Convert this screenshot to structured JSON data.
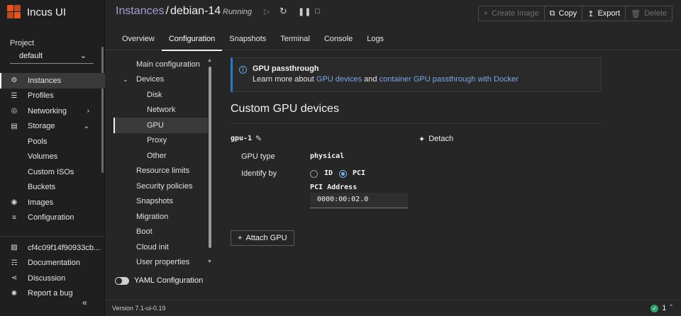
{
  "app": {
    "name": "Incus UI"
  },
  "sidebar": {
    "project_label": "Project",
    "project_value": "default",
    "items": [
      {
        "label": "Instances",
        "icon": "instances-icon"
      },
      {
        "label": "Profiles",
        "icon": "profiles-icon"
      },
      {
        "label": "Networking",
        "icon": "networking-icon"
      },
      {
        "label": "Storage",
        "icon": "storage-icon"
      },
      {
        "label": "Pools"
      },
      {
        "label": "Volumes"
      },
      {
        "label": "Custom ISOs"
      },
      {
        "label": "Buckets"
      },
      {
        "label": "Images",
        "icon": "images-icon"
      },
      {
        "label": "Configuration",
        "icon": "configuration-icon"
      }
    ],
    "bottom_items": [
      {
        "label": "cf4c09f14f90933cb...",
        "icon": "lock-icon"
      },
      {
        "label": "Documentation",
        "icon": "book-icon"
      },
      {
        "label": "Discussion",
        "icon": "share-icon"
      },
      {
        "label": "Report a bug",
        "icon": "bug-icon"
      }
    ]
  },
  "header": {
    "breadcrumb_root": "Instances",
    "separator": "/",
    "instance_name": "debian-14",
    "status": "Running",
    "actions": {
      "create_image": "Create Image",
      "copy": "Copy",
      "export": "Export",
      "delete": "Delete"
    }
  },
  "tabs": [
    "Overview",
    "Configuration",
    "Snapshots",
    "Terminal",
    "Console",
    "Logs"
  ],
  "config_nav": {
    "main": "Main configuration",
    "devices": "Devices",
    "disk": "Disk",
    "network": "Network",
    "gpu": "GPU",
    "proxy": "Proxy",
    "other": "Other",
    "resource_limits": "Resource limits",
    "security_policies": "Security policies",
    "snapshots": "Snapshots",
    "migration": "Migration",
    "boot": "Boot",
    "cloud_init": "Cloud init",
    "user_properties": "User properties"
  },
  "yaml_toggle": "YAML Configuration",
  "notice": {
    "title": "GPU passthrough",
    "prefix": "Learn more about ",
    "link1": "GPU devices",
    "middle": " and ",
    "link2": "container GPU passthrough with Docker"
  },
  "section": {
    "title": "Custom GPU devices",
    "gpu_name": "gpu-1",
    "detach": "Detach",
    "gpu_type_label": "GPU type",
    "gpu_type_value": "physical",
    "identify_label": "Identify by",
    "opt_id": "ID",
    "opt_pci": "PCI",
    "identify_selected": "PCI",
    "pci_label": "PCI Address",
    "pci_value": "0000:00:02.0",
    "attach": "Attach GPU"
  },
  "footer": {
    "version": "Version 7.1-ui-0.19",
    "notifications": "1"
  },
  "colors": {
    "accent_link": "#a99cd6",
    "info": "#2c7bc4",
    "success": "#2ea36b",
    "logo": "#e95420"
  }
}
